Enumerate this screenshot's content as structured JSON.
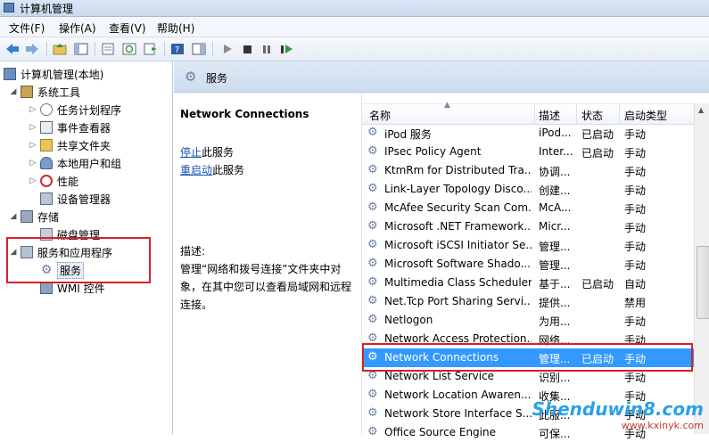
{
  "window": {
    "title": "计算机管理"
  },
  "menu": [
    "文件(F)",
    "操作(A)",
    "查看(V)",
    "帮助(H)"
  ],
  "tree": [
    {
      "label": "计算机管理(本地)",
      "icon": "computer-icon",
      "arrow": ""
    },
    {
      "label": "系统工具",
      "icon": "tools-icon",
      "arrow": "◢"
    },
    {
      "label": "任务计划程序",
      "icon": "clock-icon",
      "arrow": "▷"
    },
    {
      "label": "事件查看器",
      "icon": "event-viewer-icon",
      "arrow": "▷"
    },
    {
      "label": "共享文件夹",
      "icon": "shared-folder-icon",
      "arrow": "▷"
    },
    {
      "label": "本地用户和组",
      "icon": "users-icon",
      "arrow": "▷"
    },
    {
      "label": "性能",
      "icon": "performance-icon",
      "arrow": "▷"
    },
    {
      "label": "设备管理器",
      "icon": "device-manager-icon",
      "arrow": ""
    },
    {
      "label": "存储",
      "icon": "storage-icon",
      "arrow": "◢"
    },
    {
      "label": "磁盘管理",
      "icon": "disk-icon",
      "arrow": ""
    },
    {
      "label": "服务和应用程序",
      "icon": "services-apps-icon",
      "arrow": "◢"
    },
    {
      "label": "服务",
      "icon": "gear-icon",
      "arrow": ""
    },
    {
      "label": "WMI 控件",
      "icon": "wmi-icon",
      "arrow": ""
    }
  ],
  "services_header": {
    "title": "服务"
  },
  "description": {
    "service_name": "Network Connections",
    "stop_link": "停止",
    "stop_text": "此服务",
    "restart_link": "重启动",
    "restart_text": "此服务",
    "label": "描述:",
    "text": "管理“网络和拨号连接”文件夹中对象，在其中您可以查看局域网和远程连接。"
  },
  "columns": {
    "name": "名称",
    "desc": "描述",
    "status": "状态",
    "startup": "启动类型"
  },
  "services": [
    {
      "name": "iPod 服务",
      "desc": "iPod...",
      "status": "已启动",
      "startup": "手动"
    },
    {
      "name": "IPsec Policy Agent",
      "desc": "Inter...",
      "status": "已启动",
      "startup": "手动"
    },
    {
      "name": "KtmRm for Distributed Tra...",
      "desc": "协调...",
      "status": "",
      "startup": "手动"
    },
    {
      "name": "Link-Layer Topology Disco...",
      "desc": "创建...",
      "status": "",
      "startup": "手动"
    },
    {
      "name": "McAfee Security Scan Com...",
      "desc": "McA...",
      "status": "",
      "startup": "手动"
    },
    {
      "name": "Microsoft .NET Framework...",
      "desc": "Micr...",
      "status": "",
      "startup": "手动"
    },
    {
      "name": "Microsoft iSCSI Initiator Se...",
      "desc": "管理...",
      "status": "",
      "startup": "手动"
    },
    {
      "name": "Microsoft Software Shado...",
      "desc": "管理...",
      "status": "",
      "startup": "手动"
    },
    {
      "name": "Multimedia Class Scheduler",
      "desc": "基于...",
      "status": "已启动",
      "startup": "自动"
    },
    {
      "name": "Net.Tcp Port Sharing Servi...",
      "desc": "提供...",
      "status": "",
      "startup": "禁用"
    },
    {
      "name": "Netlogon",
      "desc": "为用...",
      "status": "",
      "startup": "手动"
    },
    {
      "name": "Network Access Protection...",
      "desc": "网络...",
      "status": "",
      "startup": "手动"
    },
    {
      "name": "Network Connections",
      "desc": "管理...",
      "status": "已启动",
      "startup": "手动"
    },
    {
      "name": "Network List Service",
      "desc": "识别...",
      "status": "",
      "startup": "手动"
    },
    {
      "name": "Network Location Awaren...",
      "desc": "收集...",
      "status": "",
      "startup": "手动"
    },
    {
      "name": "Network Store Interface S...",
      "desc": "此服...",
      "status": "",
      "startup": "手动"
    },
    {
      "name": "Office Source Engine",
      "desc": "可保...",
      "status": "",
      "startup": "手动"
    }
  ],
  "selected_service": "Network Connections",
  "colors": {
    "selection": "#3399ff",
    "highlight_box": "#d3202a"
  },
  "watermark": {
    "main": "Shenduwin8.com",
    "sub": "www.kxinyk.com"
  }
}
